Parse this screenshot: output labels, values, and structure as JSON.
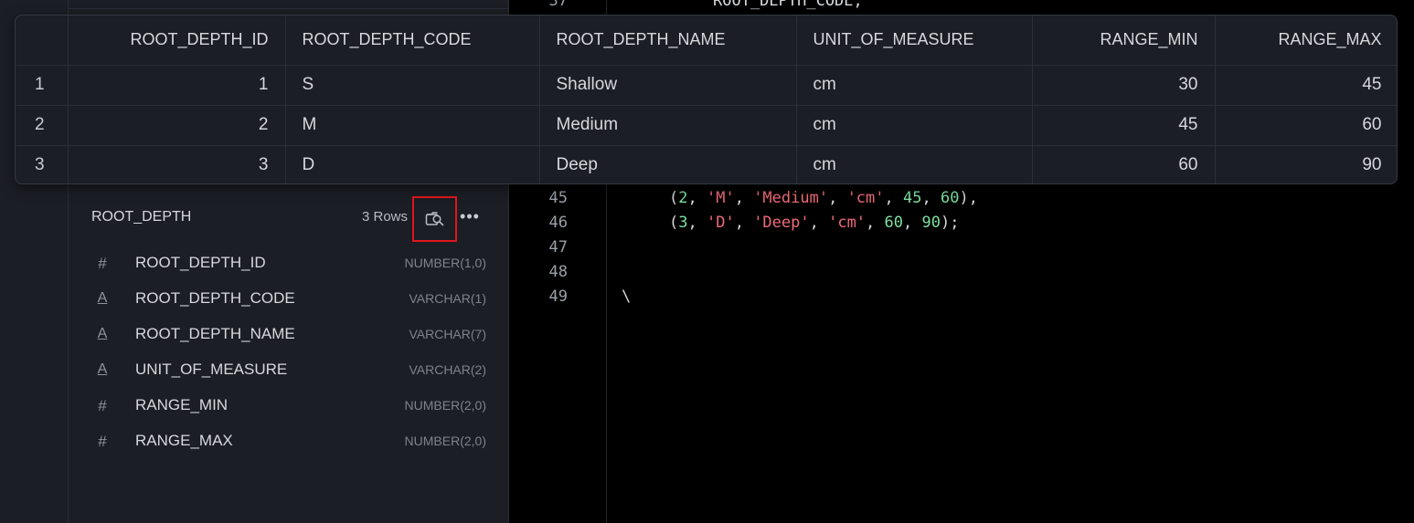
{
  "results": {
    "columns": [
      "",
      "ROOT_DEPTH_ID",
      "ROOT_DEPTH_CODE",
      "ROOT_DEPTH_NAME",
      "UNIT_OF_MEASURE",
      "RANGE_MIN",
      "RANGE_MAX"
    ],
    "rows": [
      {
        "idx": "1",
        "id": "1",
        "code": "S",
        "name": "Shallow",
        "unit": "cm",
        "min": "30",
        "max": "45"
      },
      {
        "idx": "2",
        "id": "2",
        "code": "M",
        "name": "Medium",
        "unit": "cm",
        "min": "45",
        "max": "60"
      },
      {
        "idx": "3",
        "id": "3",
        "code": "D",
        "name": "Deep",
        "unit": "cm",
        "min": "60",
        "max": "90"
      }
    ]
  },
  "sidebar": {
    "table_name": "ROOT_DEPTH",
    "row_count": "3 Rows",
    "preview_icon": "magnify-preview-icon",
    "more_icon": "ellipsis-icon",
    "more_glyph": "•••",
    "columns": [
      {
        "icon": "number-icon",
        "glyph": "#",
        "name": "ROOT_DEPTH_ID",
        "type": "NUMBER(1,0)"
      },
      {
        "icon": "text-icon",
        "glyph": "A",
        "name": "ROOT_DEPTH_CODE",
        "type": "VARCHAR(1)"
      },
      {
        "icon": "text-icon",
        "glyph": "A",
        "name": "ROOT_DEPTH_NAME",
        "type": "VARCHAR(7)"
      },
      {
        "icon": "text-icon",
        "glyph": "A",
        "name": "UNIT_OF_MEASURE",
        "type": "VARCHAR(2)"
      },
      {
        "icon": "number-icon",
        "glyph": "#",
        "name": "RANGE_MIN",
        "type": "NUMBER(2,0)"
      },
      {
        "icon": "number-icon",
        "glyph": "#",
        "name": "RANGE_MAX",
        "type": "NUMBER(2,0)"
      }
    ]
  },
  "editor": {
    "top_partial_line_number": "37",
    "top_partial_code": "ROOT_DEPTH_CODE,",
    "line_numbers": [
      "45",
      "46",
      "47",
      "48",
      "49"
    ],
    "line45": {
      "open": "(",
      "n1": "2",
      "s1": "'M'",
      "s2": "'Medium'",
      "s3": "'cm'",
      "n2": "45",
      "n3": "60",
      "close": "),"
    },
    "line46": {
      "open": "(",
      "n1": "3",
      "s1": "'D'",
      "s2": "'Deep'",
      "s3": "'cm'",
      "n2": "60",
      "n3": "90",
      "close": ");"
    },
    "line49": "\\",
    "sep": ", "
  },
  "colors": {
    "highlight_border": "#e0161c",
    "number_token": "#7be0a0",
    "string_token": "#f06b78"
  }
}
